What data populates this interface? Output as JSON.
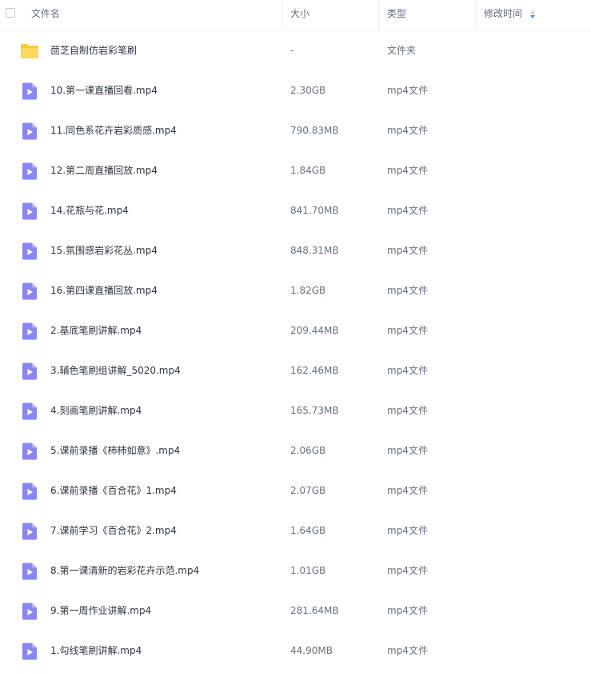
{
  "header": {
    "name": "文件名",
    "size": "大小",
    "type": "类型",
    "modified": "修改时间"
  },
  "files": [
    {
      "name": "茴芝自制仿岩彩笔刷",
      "size": "-",
      "type": "文件夹",
      "icon": "folder-icon"
    },
    {
      "name": "10.第一课直播回看.mp4",
      "size": "2.30GB",
      "type": "mp4文件",
      "icon": "video-file-icon"
    },
    {
      "name": "11.同色系花卉岩彩质感.mp4",
      "size": "790.83MB",
      "type": "mp4文件",
      "icon": "video-file-icon"
    },
    {
      "name": "12.第二周直播回放.mp4",
      "size": "1.84GB",
      "type": "mp4文件",
      "icon": "video-file-icon"
    },
    {
      "name": "14.花瓶与花.mp4",
      "size": "841.70MB",
      "type": "mp4文件",
      "icon": "video-file-icon"
    },
    {
      "name": "15.氛围感岩彩花丛.mp4",
      "size": "848.31MB",
      "type": "mp4文件",
      "icon": "video-file-icon"
    },
    {
      "name": "16.第四课直播回放.mp4",
      "size": "1.82GB",
      "type": "mp4文件",
      "icon": "video-file-icon"
    },
    {
      "name": "2.基底笔刷讲解.mp4",
      "size": "209.44MB",
      "type": "mp4文件",
      "icon": "video-file-icon"
    },
    {
      "name": "3.辅色笔刷组讲解_5020.mp4",
      "size": "162.46MB",
      "type": "mp4文件",
      "icon": "video-file-icon"
    },
    {
      "name": "4.刻画笔刷讲解.mp4",
      "size": "165.73MB",
      "type": "mp4文件",
      "icon": "video-file-icon"
    },
    {
      "name": "5.课前录播《柿柿如意》.mp4",
      "size": "2.06GB",
      "type": "mp4文件",
      "icon": "video-file-icon"
    },
    {
      "name": "6.课前录播《百合花》1.mp4",
      "size": "2.07GB",
      "type": "mp4文件",
      "icon": "video-file-icon"
    },
    {
      "name": "7.课前学习《百合花》2.mp4",
      "size": "1.64GB",
      "type": "mp4文件",
      "icon": "video-file-icon"
    },
    {
      "name": "8.第一课清新的岩彩花卉示范.mp4",
      "size": "1.01GB",
      "type": "mp4文件",
      "icon": "video-file-icon"
    },
    {
      "name": "9.第一周作业讲解.mp4",
      "size": "281.64MB",
      "type": "mp4文件",
      "icon": "video-file-icon"
    },
    {
      "name": "1.勾线笔刷讲解.mp4",
      "size": "44.90MB",
      "type": "mp4文件",
      "icon": "video-file-icon"
    }
  ],
  "colors": {
    "folder": "#fdc83a",
    "video": "#8a86f5",
    "sort_accent": "#4a8df8"
  }
}
